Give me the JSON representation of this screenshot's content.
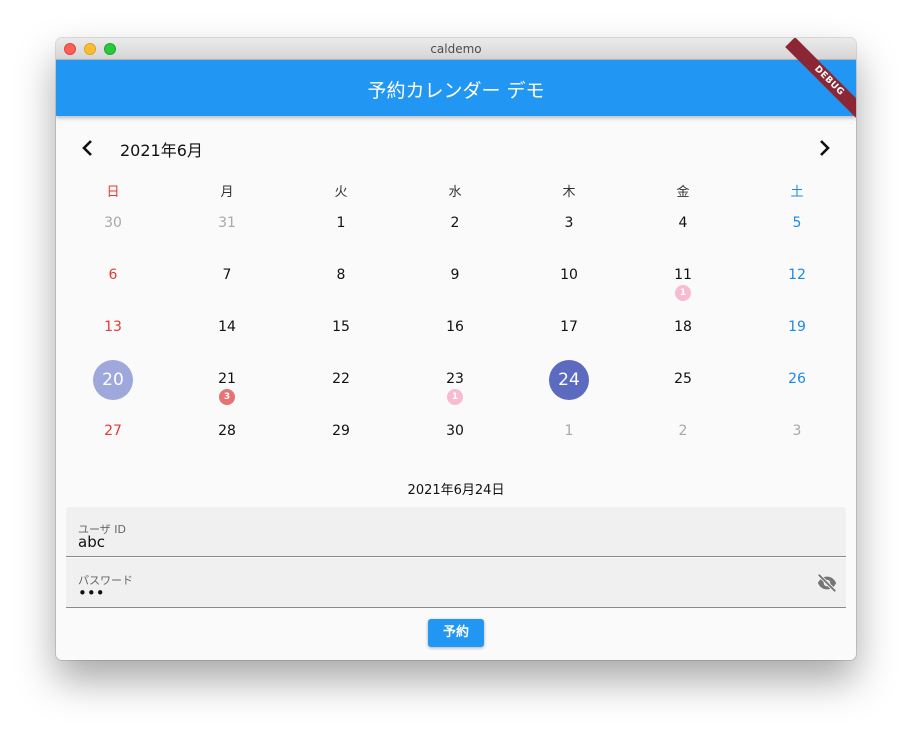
{
  "window": {
    "title": "caldemo"
  },
  "appbar": {
    "title": "予約カレンダー デモ",
    "debug_banner": "DEBUG",
    "color": "#2196f3"
  },
  "calendar": {
    "month_label": "2021年6月",
    "prev_icon": "chevron-left-icon",
    "next_icon": "chevron-right-icon",
    "weekdays": [
      "日",
      "月",
      "火",
      "水",
      "木",
      "金",
      "土"
    ],
    "today_color": "#9fa8da",
    "selected_color": "#5c6bc0",
    "weeks": [
      [
        {
          "day": "30",
          "out": true
        },
        {
          "day": "31",
          "out": true
        },
        {
          "day": "1"
        },
        {
          "day": "2"
        },
        {
          "day": "3"
        },
        {
          "day": "4"
        },
        {
          "day": "5"
        }
      ],
      [
        {
          "day": "6"
        },
        {
          "day": "7"
        },
        {
          "day": "8"
        },
        {
          "day": "9"
        },
        {
          "day": "10"
        },
        {
          "day": "11",
          "count": "1",
          "marker": "pink"
        },
        {
          "day": "12"
        }
      ],
      [
        {
          "day": "13"
        },
        {
          "day": "14"
        },
        {
          "day": "15"
        },
        {
          "day": "16"
        },
        {
          "day": "17"
        },
        {
          "day": "18"
        },
        {
          "day": "19"
        }
      ],
      [
        {
          "day": "20",
          "today": true
        },
        {
          "day": "21",
          "count": "3",
          "marker": "red"
        },
        {
          "day": "22"
        },
        {
          "day": "23",
          "count": "1",
          "marker": "pink"
        },
        {
          "day": "24",
          "selected": true
        },
        {
          "day": "25"
        },
        {
          "day": "26"
        }
      ],
      [
        {
          "day": "27"
        },
        {
          "day": "28"
        },
        {
          "day": "29"
        },
        {
          "day": "30"
        },
        {
          "day": "1",
          "out": true
        },
        {
          "day": "2",
          "out": true
        },
        {
          "day": "3",
          "out": true
        }
      ]
    ]
  },
  "selected_date": "2021年6月24日",
  "form": {
    "user_label": "ユーザ ID",
    "user_value": "abc",
    "password_label": "パスワード",
    "password_value": "•••",
    "visibility_icon": "visibility-off-icon",
    "submit_label": "予約"
  }
}
